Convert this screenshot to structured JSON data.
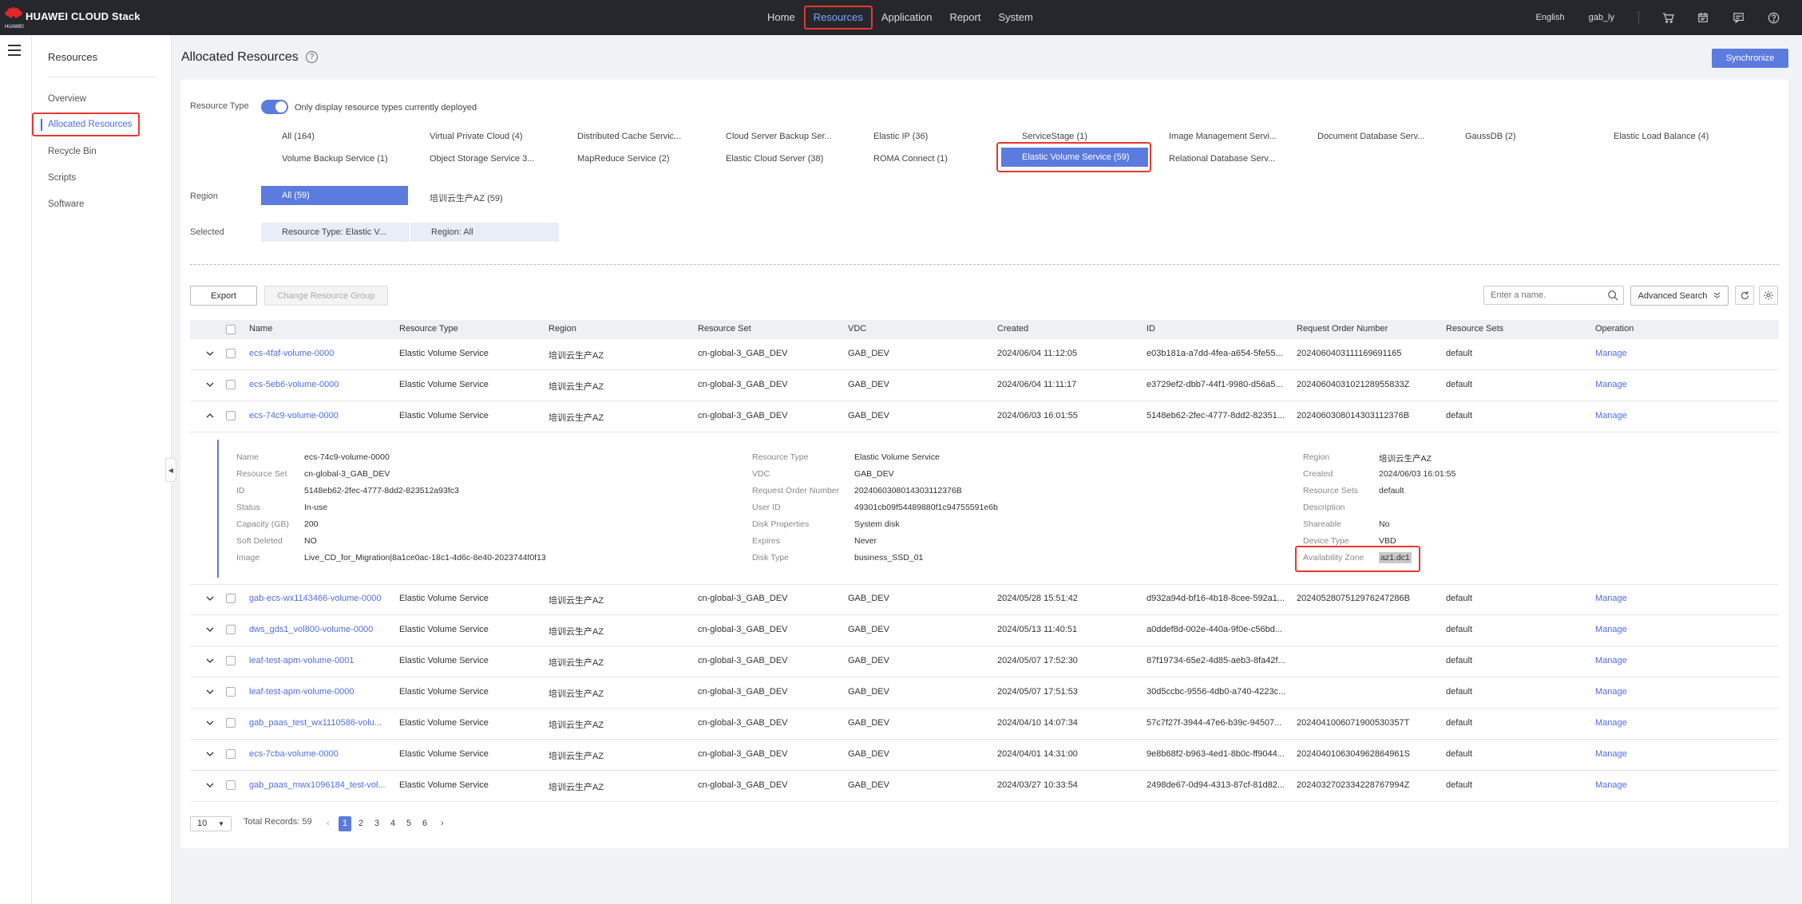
{
  "topbar": {
    "brand": "HUAWEI CLOUD Stack",
    "brand_sub": "HUAWEI",
    "nav": [
      "Home",
      "Resources",
      "Application",
      "Report",
      "System"
    ],
    "active_nav": "Resources",
    "language": "English",
    "user": "gab_ly",
    "icons": [
      "cart-icon",
      "calendar-icon",
      "message-icon",
      "help-icon"
    ]
  },
  "sidebar": {
    "title": "Resources",
    "items": [
      "Overview",
      "Allocated Resources",
      "Recycle Bin",
      "Scripts",
      "Software"
    ],
    "active": "Allocated Resources"
  },
  "page": {
    "title": "Allocated Resources",
    "sync_label": "Synchronize"
  },
  "filters": {
    "resource_type_label": "Resource Type",
    "toggle_label": "Only display resource types currently deployed",
    "toggle_on": true,
    "resource_types_row1": [
      "All (164)",
      "Virtual Private Cloud (4)",
      "Distributed Cache Servic...",
      "Cloud Server Backup Ser...",
      "Elastic IP (36)",
      "ServiceStage (1)",
      "Image Management Servi...",
      "Document Database Serv...",
      "GaussDB (2)",
      "Elastic Load Balance (4)"
    ],
    "resource_types_row2": [
      "Volume Backup Service (1)",
      "Object Storage Service 3...",
      "MapReduce Service (2)",
      "Elastic Cloud Server (38)",
      "ROMA Connect (1)",
      "Elastic Volume Service (59)",
      "Relational Database Serv..."
    ],
    "selected_type": "Elastic Volume Service (59)",
    "region_label": "Region",
    "regions": [
      "All (59)",
      "培训云生产AZ (59)"
    ],
    "selected_region": "All (59)",
    "selected_label": "Selected",
    "selected_chips": [
      "Resource Type: Elastic V...",
      "Region: All"
    ]
  },
  "toolbar": {
    "export": "Export",
    "change_group": "Change Resource Group",
    "search_placeholder": "Enter a name.",
    "advanced_search": "Advanced Search"
  },
  "table": {
    "columns": [
      "Name",
      "Resource Type",
      "Region",
      "Resource Set",
      "VDC",
      "Created",
      "ID",
      "Request Order Number",
      "Resource Sets",
      "Operation"
    ],
    "rows": [
      {
        "name": "ecs-4faf-volume-0000",
        "type": "Elastic Volume Service",
        "region": "培训云生产AZ",
        "set": "cn-global-3_GAB_DEV",
        "vdc": "GAB_DEV",
        "created": "2024/06/04 11:12:05",
        "id": "e03b181a-a7dd-4fea-a654-5fe55...",
        "order": "2024060403111169691165",
        "sets": "default",
        "op": "Manage",
        "expanded": false
      },
      {
        "name": "ecs-5eb6-volume-0000",
        "type": "Elastic Volume Service",
        "region": "培训云生产AZ",
        "set": "cn-global-3_GAB_DEV",
        "vdc": "GAB_DEV",
        "created": "2024/06/04 11:11:17",
        "id": "e3729ef2-dbb7-44f1-9980-d56a5...",
        "order": "2024060403102128955833Z",
        "sets": "default",
        "op": "Manage",
        "expanded": false
      },
      {
        "name": "ecs-74c9-volume-0000",
        "type": "Elastic Volume Service",
        "region": "培训云生产AZ",
        "set": "cn-global-3_GAB_DEV",
        "vdc": "GAB_DEV",
        "created": "2024/06/03 16:01:55",
        "id": "5148eb62-2fec-4777-8dd2-82351...",
        "order": "2024060308014303112376B",
        "sets": "default",
        "op": "Manage",
        "expanded": true
      },
      {
        "name": "gab-ecs-wx1143466-volume-0000",
        "type": "Elastic Volume Service",
        "region": "培训云生产AZ",
        "set": "cn-global-3_GAB_DEV",
        "vdc": "GAB_DEV",
        "created": "2024/05/28 15:51:42",
        "id": "d932a94d-bf16-4b18-8cee-592a1...",
        "order": "2024052807512976247286B",
        "sets": "default",
        "op": "Manage",
        "expanded": false
      },
      {
        "name": "dws_gds1_vol800-volume-0000",
        "type": "Elastic Volume Service",
        "region": "培训云生产AZ",
        "set": "cn-global-3_GAB_DEV",
        "vdc": "GAB_DEV",
        "created": "2024/05/13 11:40:51",
        "id": "a0ddef8d-002e-440a-9f0e-c56bd...",
        "order": "",
        "sets": "default",
        "op": "Manage",
        "expanded": false
      },
      {
        "name": "leaf-test-apm-volume-0001",
        "type": "Elastic Volume Service",
        "region": "培训云生产AZ",
        "set": "cn-global-3_GAB_DEV",
        "vdc": "GAB_DEV",
        "created": "2024/05/07 17:52:30",
        "id": "87f19734-65e2-4d85-aeb3-8fa42f...",
        "order": "",
        "sets": "default",
        "op": "Manage",
        "expanded": false
      },
      {
        "name": "leaf-test-apm-volume-0000",
        "type": "Elastic Volume Service",
        "region": "培训云生产AZ",
        "set": "cn-global-3_GAB_DEV",
        "vdc": "GAB_DEV",
        "created": "2024/05/07 17:51:53",
        "id": "30d5ccbc-9556-4db0-a740-4223c...",
        "order": "",
        "sets": "default",
        "op": "Manage",
        "expanded": false
      },
      {
        "name": "gab_paas_test_wx1110586-volu...",
        "type": "Elastic Volume Service",
        "region": "培训云生产AZ",
        "set": "cn-global-3_GAB_DEV",
        "vdc": "GAB_DEV",
        "created": "2024/04/10 14:07:34",
        "id": "57c7f27f-3944-47e6-b39c-94507...",
        "order": "2024041006071900530357T",
        "sets": "default",
        "op": "Manage",
        "expanded": false
      },
      {
        "name": "ecs-7cba-volume-0000",
        "type": "Elastic Volume Service",
        "region": "培训云生产AZ",
        "set": "cn-global-3_GAB_DEV",
        "vdc": "GAB_DEV",
        "created": "2024/04/01 14:31:00",
        "id": "9e8b68f2-b963-4ed1-8b0c-ff9044...",
        "order": "2024040106304962864961S",
        "sets": "default",
        "op": "Manage",
        "expanded": false
      },
      {
        "name": "gab_paas_mwx1096184_test-vol...",
        "type": "Elastic Volume Service",
        "region": "培训云生产AZ",
        "set": "cn-global-3_GAB_DEV",
        "vdc": "GAB_DEV",
        "created": "2024/03/27 10:33:54",
        "id": "2498de67-0d94-4313-87cf-81d82...",
        "order": "2024032702334228767994Z",
        "sets": "default",
        "op": "Manage",
        "expanded": false
      }
    ]
  },
  "detail": {
    "left": [
      {
        "k": "Name",
        "v": "ecs-74c9-volume-0000"
      },
      {
        "k": "Resource Set",
        "v": "cn-global-3_GAB_DEV"
      },
      {
        "k": "ID",
        "v": "5148eb62-2fec-4777-8dd2-823512a93fc3"
      },
      {
        "k": "Status",
        "v": "In-use"
      },
      {
        "k": "Capacity (GB)",
        "v": "200"
      },
      {
        "k": "Soft Deleted",
        "v": "NO"
      },
      {
        "k": "Image",
        "v": "Live_CD_for_Migration|8a1ce0ac-18c1-4d6c-8e40-2023744f0f13"
      }
    ],
    "middle": [
      {
        "k": "Resource Type",
        "v": "Elastic Volume Service"
      },
      {
        "k": "VDC",
        "v": "GAB_DEV"
      },
      {
        "k": "Request Order Number",
        "v": "2024060308014303112376B"
      },
      {
        "k": "User ID",
        "v": "49301cb09f54489880f1c94755591e6b"
      },
      {
        "k": "Disk Properties",
        "v": "System disk"
      },
      {
        "k": "Expires",
        "v": "Never"
      },
      {
        "k": "Disk Type",
        "v": "business_SSD_01"
      }
    ],
    "right": [
      {
        "k": "Region",
        "v": "培训云生产AZ"
      },
      {
        "k": "Created",
        "v": "2024/06/03 16:01:55"
      },
      {
        "k": "Resource Sets",
        "v": "default"
      },
      {
        "k": "Description",
        "v": ""
      },
      {
        "k": "Shareable",
        "v": "No"
      },
      {
        "k": "Device Type",
        "v": "VBD"
      },
      {
        "k": "Availability Zone",
        "v": "az1.dc1"
      }
    ]
  },
  "pagination": {
    "page_size": "10",
    "total": "Total Records: 59",
    "pages": [
      "1",
      "2",
      "3",
      "4",
      "5",
      "6"
    ],
    "current": "1"
  },
  "colors": {
    "accent": "#5b7bdf",
    "highlight_box": "#e53a2e",
    "topbar": "#25272c"
  }
}
